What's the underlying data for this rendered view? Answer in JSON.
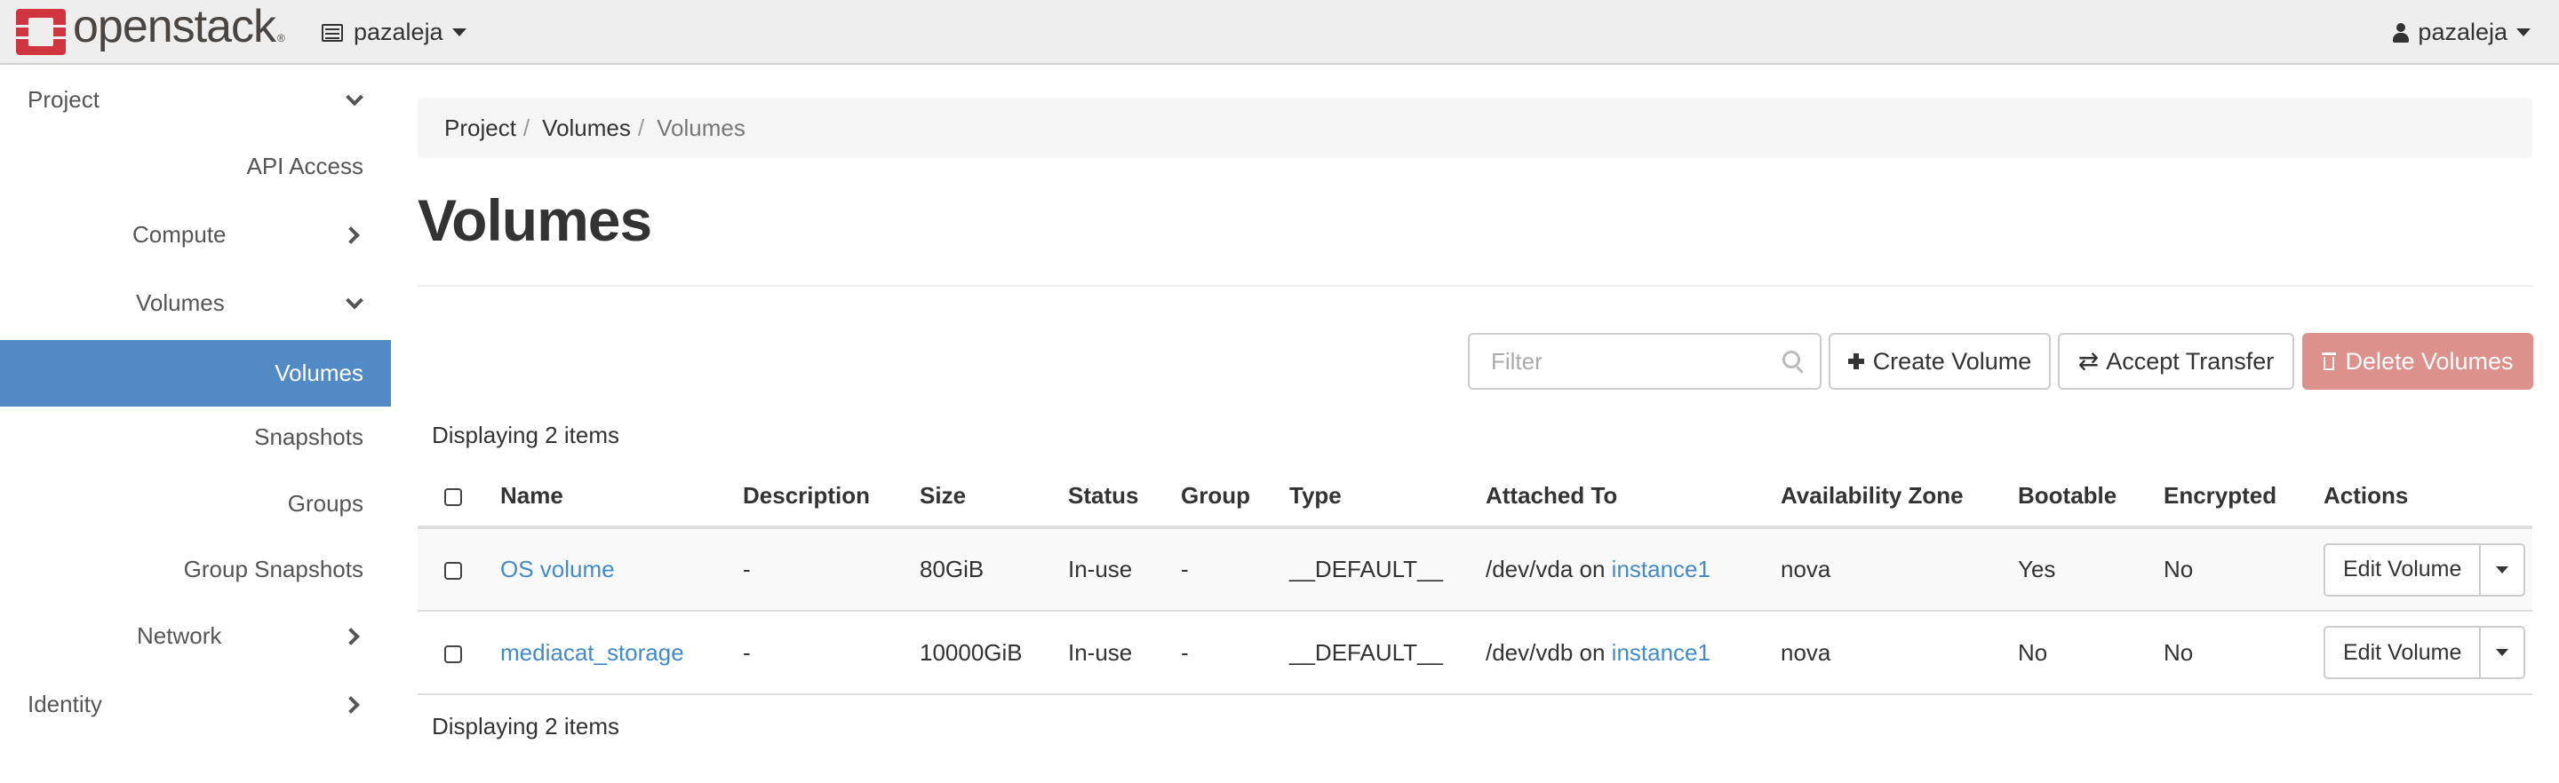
{
  "header": {
    "brand": "openstack",
    "project_selector": "pazaleja",
    "user_menu": "pazaleja"
  },
  "sidebar": {
    "items": [
      {
        "label": "Project",
        "level": 0,
        "icon": "chevron-down-icon"
      },
      {
        "label": "API Access",
        "level": 2,
        "icon": ""
      },
      {
        "label": "Compute",
        "level": 1,
        "icon": "chevron-right-icon"
      },
      {
        "label": "Volumes",
        "level": 1,
        "icon": "chevron-down-icon"
      },
      {
        "label": "Volumes",
        "level": 2,
        "icon": "",
        "active": true
      },
      {
        "label": "Snapshots",
        "level": 2,
        "icon": ""
      },
      {
        "label": "Groups",
        "level": 2,
        "icon": ""
      },
      {
        "label": "Group Snapshots",
        "level": 2,
        "icon": ""
      },
      {
        "label": "Network",
        "level": 1,
        "icon": "chevron-right-icon"
      },
      {
        "label": "Identity",
        "level": 0,
        "icon": "chevron-right-icon"
      }
    ],
    "active_color": "#528ac6"
  },
  "breadcrumb": {
    "items": [
      "Project",
      "Volumes",
      "Volumes"
    ],
    "separator": "/"
  },
  "page": {
    "title": "Volumes"
  },
  "toolbar": {
    "filter_placeholder": "Filter",
    "filter_value": "",
    "create_label": "Create Volume",
    "accept_label": "Accept Transfer",
    "delete_label": "Delete Volumes",
    "delete_color": "#dc918d"
  },
  "table": {
    "count_text": "Displaying 2 items",
    "columns": [
      "Name",
      "Description",
      "Size",
      "Status",
      "Group",
      "Type",
      "Attached To",
      "Availability Zone",
      "Bootable",
      "Encrypted",
      "Actions"
    ],
    "rows": [
      {
        "name": "OS volume",
        "description": "-",
        "size": "80GiB",
        "status": "In-use",
        "group": "-",
        "type": "__DEFAULT__",
        "attached_prefix": "/dev/vda on",
        "attached_instance": "instance1",
        "availability_zone": "nova",
        "bootable": "Yes",
        "encrypted": "No",
        "action": "Edit Volume"
      },
      {
        "name": "mediacat_storage",
        "description": "-",
        "size": "10000GiB",
        "status": "In-use",
        "group": "-",
        "type": "__DEFAULT__",
        "attached_prefix": "/dev/vdb on",
        "attached_instance": "instance1",
        "availability_zone": "nova",
        "bootable": "No",
        "encrypted": "No",
        "action": "Edit Volume"
      }
    ]
  }
}
